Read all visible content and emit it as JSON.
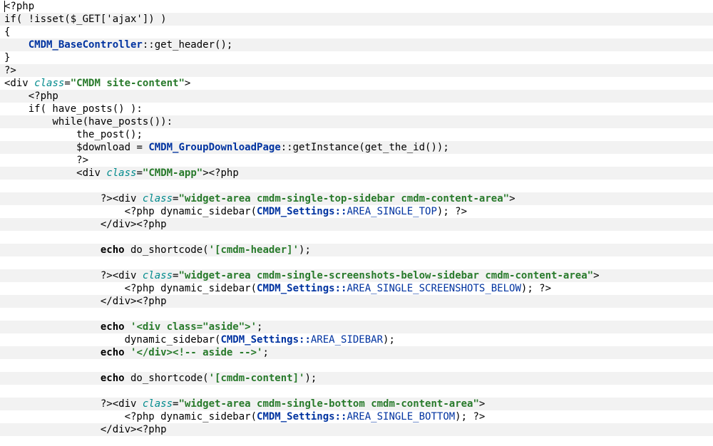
{
  "code": {
    "open_php": "<?php",
    "if_isset": "if( !isset($_GET['ajax']) )",
    "brace_open": "{",
    "base_ctrl_class": "CMDM_BaseController",
    "scope": "::",
    "get_header": "get_header();",
    "brace_close": "}",
    "close_php": "?>",
    "div_open": "<div ",
    "class_attr": "class",
    "equals": "=",
    "site_content_cls": "\"CMDM site-content\"",
    "gt": ">",
    "indent_open_php": "<?php",
    "if_have_posts": "if( have_posts() ):",
    "while_have_posts": "while(have_posts()):",
    "the_post": "the_post();",
    "dl_assign_pre": "$download = ",
    "gdp_class": "CMDM_GroupDownloadPage",
    "get_instance": "getInstance(get_the_id());",
    "close_php_short": "?>",
    "div_app_open": "<div ",
    "cmdm_app_cls": "\"CMDM-app\"",
    "gt2": "><?php",
    "open_inline1": "?><div ",
    "widget_top_cls": "\"widget-area cmdm-single-top-sidebar cmdm-content-area\"",
    "dyn_sidebar_pre": "<?php dynamic_sidebar(",
    "settings_class": "CMDM_Settings",
    "area_top": "AREA_SINGLE_TOP",
    "dyn_sidebar_post": "); ?>",
    "close_div_php": "</div><?php",
    "echo_do_header": "echo do_shortcode('[cmdm-header]');",
    "open_inline2": "?><div ",
    "widget_ss_cls": "\"widget-area cmdm-single-screenshots-below-sidebar cmdm-content-area\"",
    "area_ss": "AREA_SINGLE_SCREENSHOTS_BELOW",
    "echo_aside_open": "echo '<div class=\"aside\">';",
    "dyn_sidebar_call_pre": "dynamic_sidebar(",
    "area_sidebar": "AREA_SIDEBAR",
    "dyn_sidebar_call_post": ");",
    "echo_aside_close": "echo '</div><!-- aside -->';",
    "echo_do_content": "echo do_shortcode('[cmdm-content]');",
    "open_inline3": "?><div ",
    "widget_bottom_cls": "\"widget-area cmdm-single-bottom cmdm-content-area\"",
    "area_bottom": "AREA_SINGLE_BOTTOM"
  }
}
